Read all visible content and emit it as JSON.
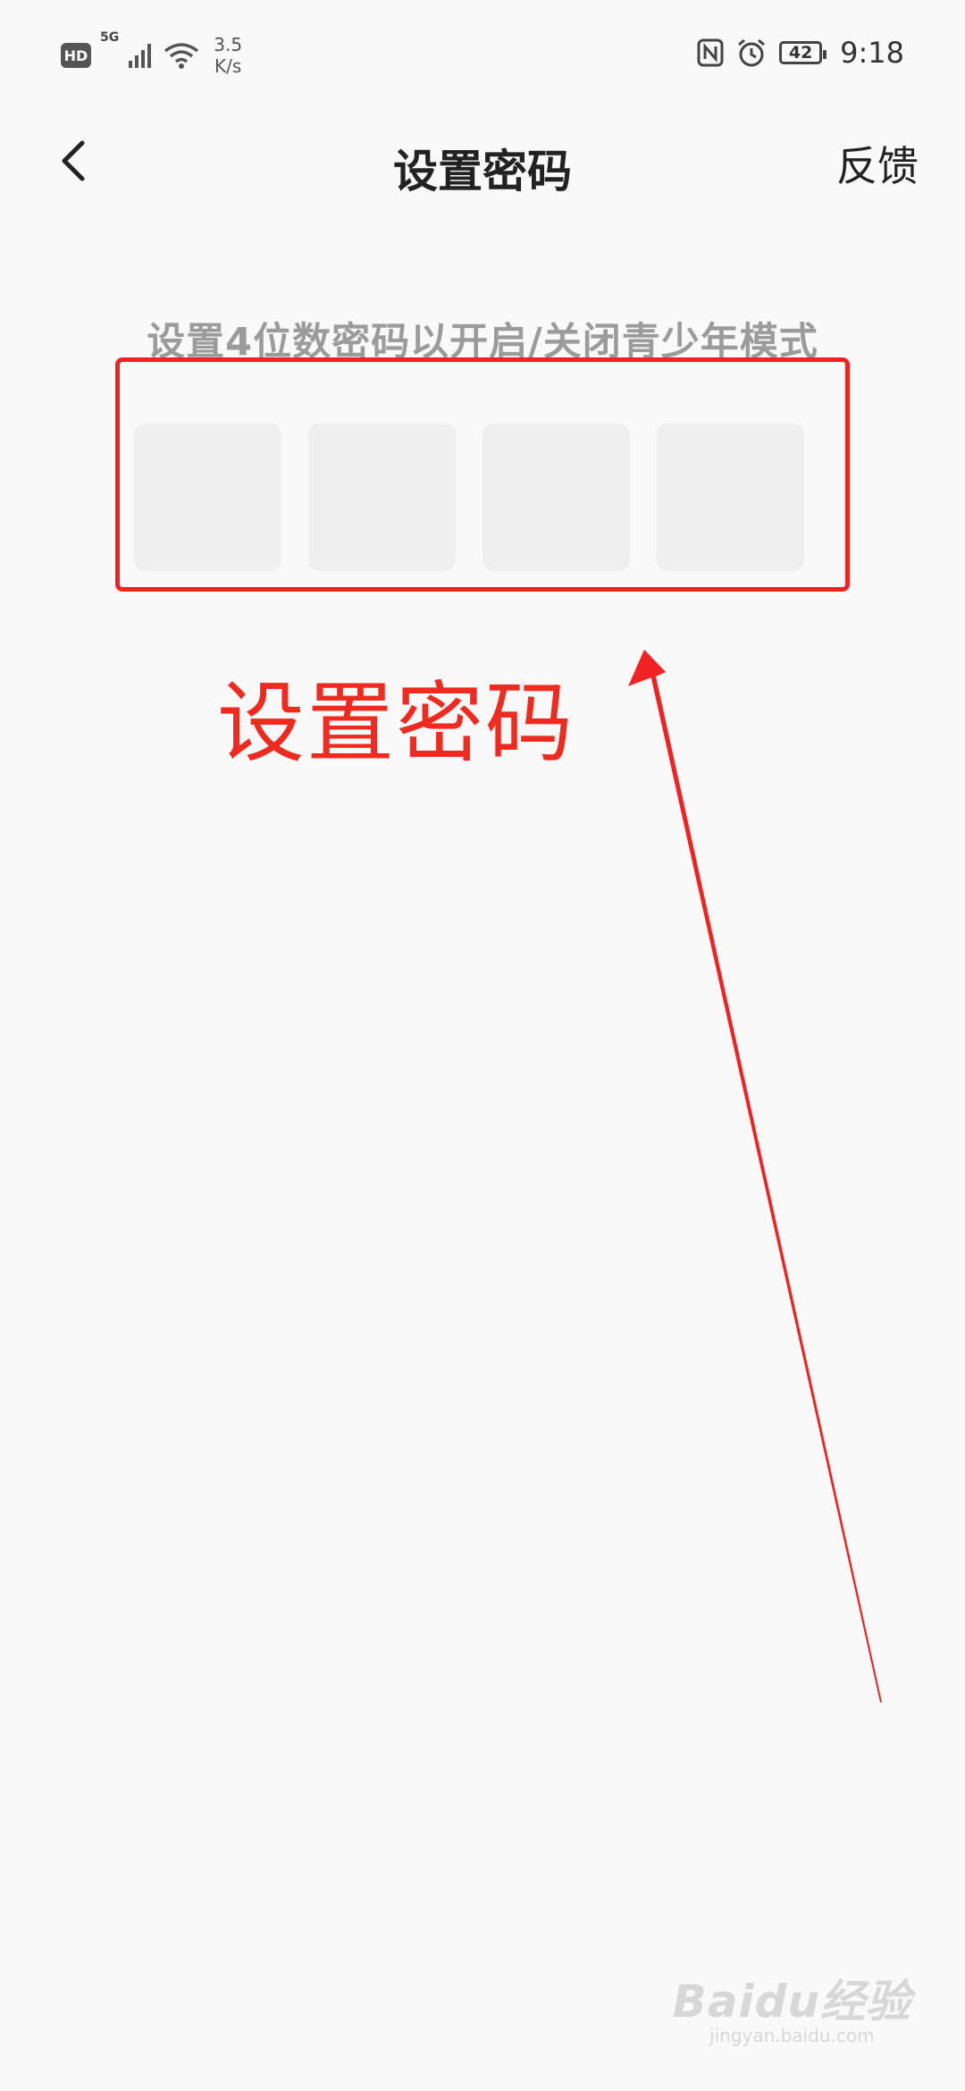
{
  "status_bar": {
    "hd": "HD",
    "network": "5G",
    "speed_value": "3.5",
    "speed_unit": "K/s",
    "battery": "42",
    "time": "9:18",
    "icons": [
      "signal-icon",
      "wifi-icon",
      "nfc-icon",
      "alarm-icon",
      "battery-icon"
    ]
  },
  "nav": {
    "title": "设置密码",
    "feedback": "反馈",
    "back_icon": "chevron-left-icon"
  },
  "content": {
    "instruction": "设置4位数密码以开启/关闭青少年模式",
    "pin_boxes": [
      "",
      "",
      "",
      ""
    ],
    "annotation": "设置密码"
  },
  "watermark": {
    "logo": "Baidu经验",
    "url": "jingyan.baidu.com"
  },
  "colors": {
    "annotation_red": "#f02a1f",
    "background": "#f9f9f9",
    "pin_box": "#efefef",
    "instruction_gray": "#9b9b9b"
  }
}
